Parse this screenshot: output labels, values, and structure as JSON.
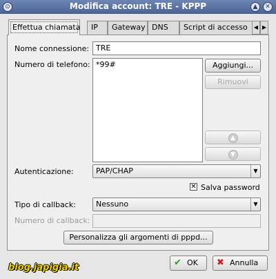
{
  "window": {
    "title": "Modifica account: TRE - KPPP",
    "menu_glyph": "⊙",
    "up_glyph": "▲",
    "close_glyph": "✕"
  },
  "tabs": [
    {
      "label": "Effettua chiamata"
    },
    {
      "label": "IP"
    },
    {
      "label": "Gateway"
    },
    {
      "label": "DNS"
    },
    {
      "label": "Script di accesso"
    }
  ],
  "tab_scroll": {
    "left": "◀",
    "right": "▶"
  },
  "form": {
    "connection_name_label": "Nome connessione:",
    "connection_name_value": "TRE",
    "phone_label": "Numero di telefono:",
    "phone_numbers": [
      "*99#"
    ],
    "add_button": "Aggiungi...",
    "remove_button": "Rimuovi",
    "auth_label": "Autenticazione:",
    "auth_value": "PAP/CHAP",
    "save_password_label": "Salva password",
    "save_password_checked": "✕",
    "callback_type_label": "Tipo di callback:",
    "callback_type_value": "Nessuno",
    "callback_number_label": "Numero di callback:",
    "callback_number_value": "",
    "pppd_args_button": "Personalizza gli argomenti di pppd..."
  },
  "footer": {
    "ok_label": "OK",
    "ok_icon": "✔",
    "cancel_label": "Annulla",
    "cancel_icon": "✖"
  },
  "watermark": "blog.japigia.it"
}
